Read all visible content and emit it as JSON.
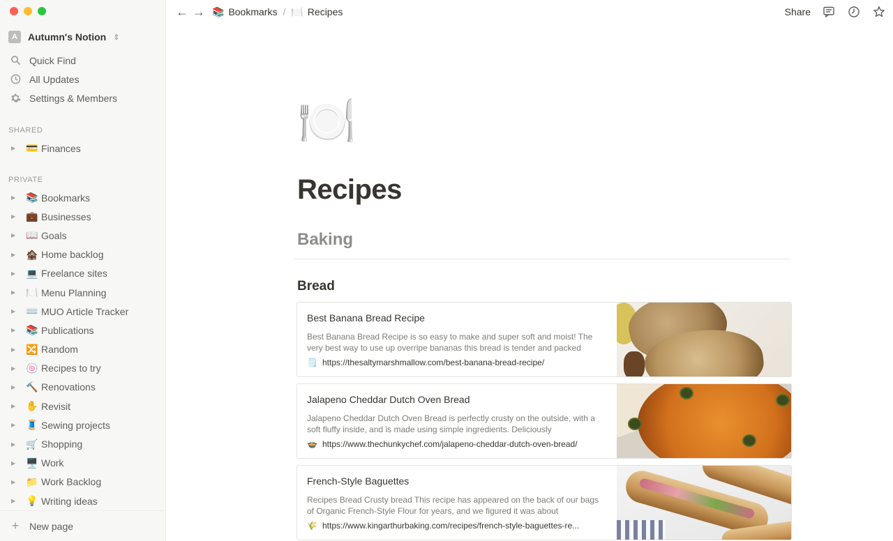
{
  "window": {
    "workspace_name": "Autumn's Notion",
    "workspace_initial": "A"
  },
  "sidebar": {
    "top_items": [
      {
        "label": "Quick Find",
        "icon": "search-icon"
      },
      {
        "label": "All Updates",
        "icon": "clock-icon"
      },
      {
        "label": "Settings & Members",
        "icon": "gear-icon"
      }
    ],
    "shared_label": "SHARED",
    "shared_items": [
      {
        "emoji": "💳",
        "label": "Finances"
      }
    ],
    "private_label": "PRIVATE",
    "private_items": [
      {
        "emoji": "📚",
        "label": "Bookmarks"
      },
      {
        "emoji": "💼",
        "label": "Businesses"
      },
      {
        "emoji": "📖",
        "label": "Goals"
      },
      {
        "emoji": "🏚️",
        "label": "Home backlog"
      },
      {
        "emoji": "💻",
        "label": "Freelance sites"
      },
      {
        "emoji": "🍽️",
        "label": "Menu Planning"
      },
      {
        "emoji": "⌨️",
        "label": "MUO Article Tracker"
      },
      {
        "emoji": "📚",
        "label": "Publications"
      },
      {
        "emoji": "🔀",
        "label": "Random"
      },
      {
        "emoji": "🍥",
        "label": "Recipes to try"
      },
      {
        "emoji": "🔨",
        "label": "Renovations"
      },
      {
        "emoji": "✋",
        "label": "Revisit"
      },
      {
        "emoji": "🧵",
        "label": "Sewing projects"
      },
      {
        "emoji": "🛒",
        "label": "Shopping"
      },
      {
        "emoji": "🖥️",
        "label": "Work"
      },
      {
        "emoji": "📁",
        "label": "Work Backlog"
      },
      {
        "emoji": "💡",
        "label": "Writing ideas"
      }
    ],
    "new_page_label": "New page"
  },
  "topbar": {
    "breadcrumbs": [
      {
        "emoji": "📚",
        "label": "Bookmarks"
      },
      {
        "emoji": "🍽️",
        "label": "Recipes"
      }
    ],
    "separator": "/",
    "share_label": "Share"
  },
  "page": {
    "icon": "🍽️",
    "title": "Recipes",
    "section_heading": "Baking",
    "subsection_heading": "Bread",
    "bookmarks": [
      {
        "title": "Best Banana Bread Recipe",
        "description": "Best Banana Bread Recipe is so easy to make and super soft and moist! The very best way to use up overripe bananas this bread is tender and packed",
        "favicon": "🗒️",
        "url": "https://thesaltymarshmallow.com/best-banana-bread-recipe/"
      },
      {
        "title": "Jalapeno Cheddar Dutch Oven Bread",
        "description": "Jalapeno Cheddar Dutch Oven Bread is perfectly crusty on the outside, with a soft fluffy inside, and is made using simple ingredients. Deliciously",
        "favicon": "🍲",
        "url": "https://www.thechunkychef.com/jalapeno-cheddar-dutch-oven-bread/"
      },
      {
        "title": "French-Style Baguettes",
        "description": "Recipes Bread Crusty bread This recipe has appeared on the back of our bags of Organic French-Style Flour for years, and we figured it was about",
        "favicon": "🌾",
        "url": "https://www.kingarthurbaking.com/recipes/french-style-baguettes-re..."
      }
    ]
  }
}
